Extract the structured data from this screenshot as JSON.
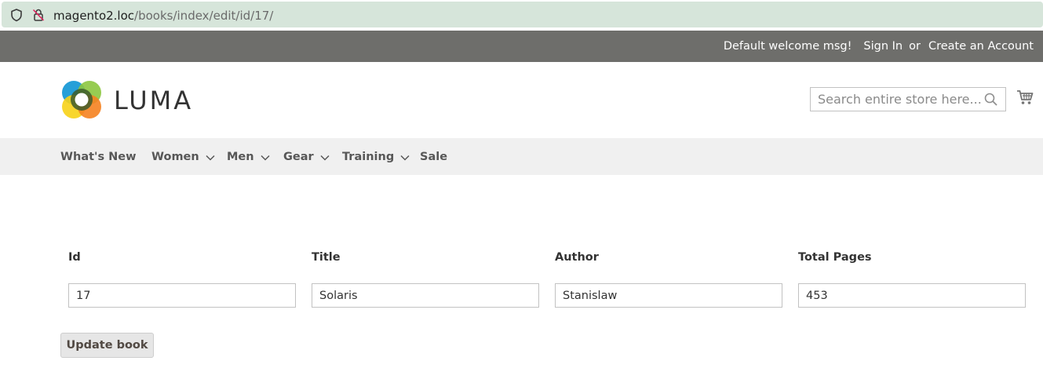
{
  "browser": {
    "url_host": "magento2.loc",
    "url_path": "/books/index/edit/id/17/"
  },
  "panel": {
    "welcome": "Default welcome msg!",
    "sign_in": "Sign In",
    "or": "or",
    "create_account": "Create an Account"
  },
  "header": {
    "logo_text": "LUMA",
    "search_placeholder": "Search entire store here..."
  },
  "nav": {
    "items": [
      {
        "label": "What's New",
        "has_dropdown": false
      },
      {
        "label": "Women",
        "has_dropdown": true
      },
      {
        "label": "Men",
        "has_dropdown": true
      },
      {
        "label": "Gear",
        "has_dropdown": true
      },
      {
        "label": "Training",
        "has_dropdown": true
      },
      {
        "label": "Sale",
        "has_dropdown": false
      }
    ]
  },
  "form": {
    "fields": [
      {
        "label": "Id",
        "value": "17"
      },
      {
        "label": "Title",
        "value": "Solaris"
      },
      {
        "label": "Author",
        "value": "Stanislaw"
      },
      {
        "label": "Total Pages",
        "value": "453"
      }
    ],
    "submit_label": "Update book"
  },
  "colors": {
    "panel_bg": "#6e6e6b",
    "nav_bg": "#f0f0f0",
    "urlbar_bg": "#d6e5da",
    "button_bg": "#e6e6e6"
  }
}
